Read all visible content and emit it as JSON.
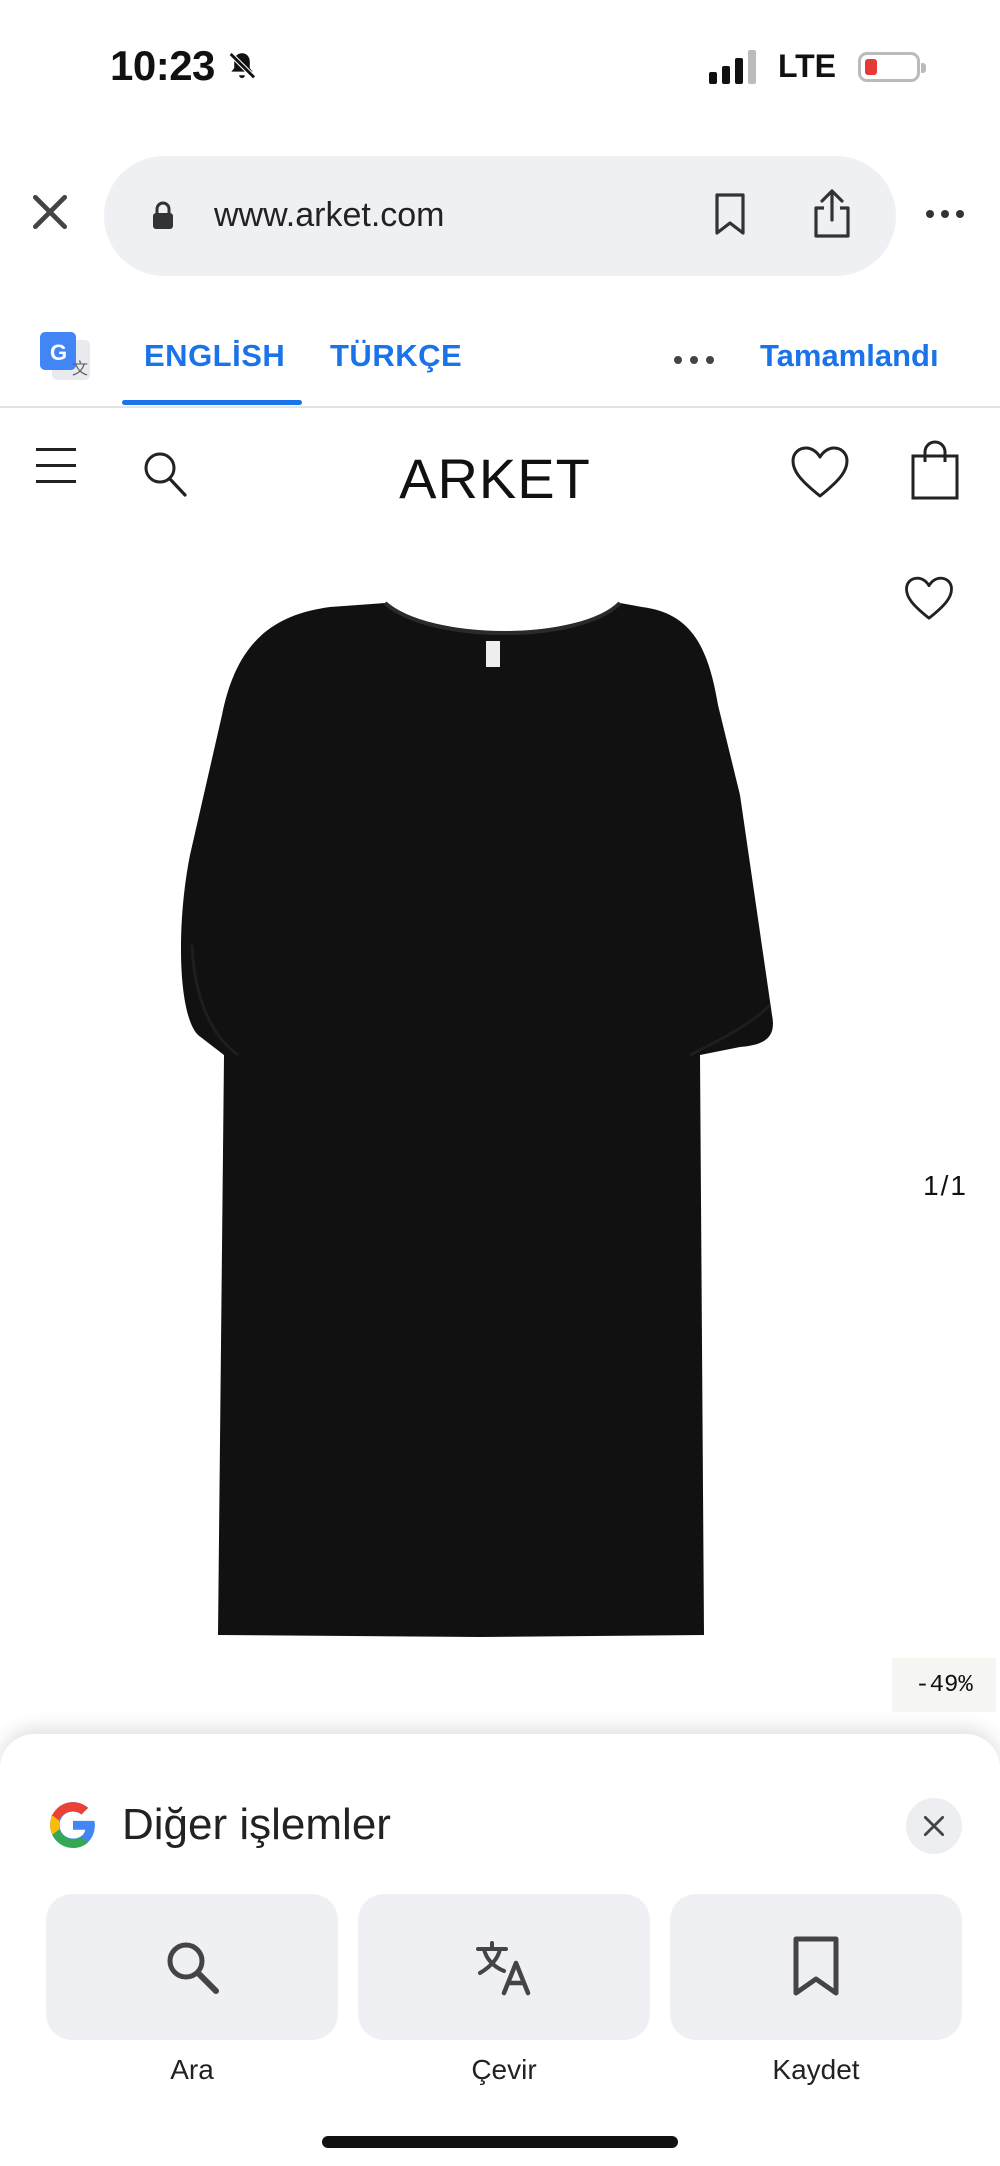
{
  "status_bar": {
    "time": "10:23",
    "network": "LTE",
    "battery_level": 0.1,
    "colors": {
      "battery_low": "#e53935"
    }
  },
  "browser": {
    "url": "www.arket.com",
    "icons": [
      "close-icon",
      "lock-icon",
      "bookmark-icon",
      "share-icon",
      "more-icon"
    ]
  },
  "translate_bar": {
    "tabs": [
      {
        "label": "ENGLİSH",
        "selected": true
      },
      {
        "label": "TÜRKÇE",
        "selected": false
      }
    ],
    "done_label": "Tamamlandı",
    "accent_color": "#1a73e8"
  },
  "site": {
    "brand": "ARKET",
    "icons": [
      "menu-icon",
      "search-icon",
      "heart-icon",
      "bag-icon"
    ]
  },
  "product": {
    "pager": "1/1",
    "discount": "-49%",
    "garment_color": "#111111"
  },
  "sheet": {
    "title": "Diğer işlemler",
    "actions": [
      {
        "label": "Ara",
        "icon": "search-icon"
      },
      {
        "label": "Çevir",
        "icon": "translate-icon"
      },
      {
        "label": "Kaydet",
        "icon": "bookmark-icon"
      }
    ]
  }
}
